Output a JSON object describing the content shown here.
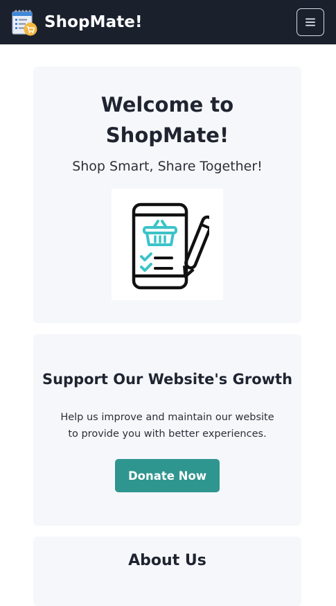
{
  "navbar": {
    "brand_name": "ShopMate!",
    "logo_icon": "shopping-list-cart-icon",
    "menu_icon": "hamburger-menu-icon"
  },
  "hero": {
    "title": "Welcome to ShopMate!",
    "tagline": "Shop Smart, Share Together!",
    "image_icon": "phone-shopping-list-pen-icon"
  },
  "support": {
    "title": "Support Our Website's Growth",
    "text": "Help us improve and maintain our website to provide you with better experiences.",
    "button_label": "Donate Now"
  },
  "about": {
    "title": "About Us"
  },
  "colors": {
    "navbar_bg": "#1a202c",
    "card_bg": "#f5f7fa",
    "accent": "#2f958f",
    "icon_teal": "#3cc3c8"
  }
}
